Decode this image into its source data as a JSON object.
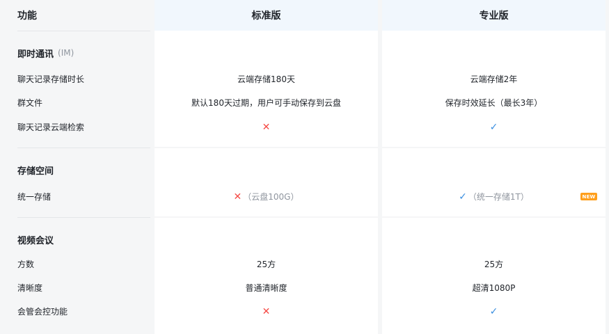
{
  "header": {
    "feature": "功能",
    "standard": "标准版",
    "professional": "专业版"
  },
  "sections": [
    {
      "title": "即时通讯",
      "subtitle": "(IM)",
      "rows": [
        {
          "label": "聊天记录存储时长",
          "standard": "云端存储180天",
          "professional": "云端存储2年"
        },
        {
          "label": "群文件",
          "standard": "默认180天过期，用户可手动保存到云盘",
          "professional": "保存时效延长（最长3年）"
        },
        {
          "label": "聊天记录云端检索",
          "standard": "✕",
          "professional": "✓"
        }
      ]
    },
    {
      "title": "存储空间",
      "rows": [
        {
          "label": "统一存储",
          "standard_icon": "✕",
          "standard": "（云盘100G）",
          "professional_icon": "✓",
          "professional": "（统一存储1T）",
          "badge": "NEW"
        }
      ]
    },
    {
      "title": "视频会议",
      "rows": [
        {
          "label": "方数",
          "standard": "25方",
          "professional": "25方"
        },
        {
          "label": "清晰度",
          "standard": "普通清晰度",
          "professional": "超清1080P"
        },
        {
          "label": "会管会控功能",
          "standard": "✕",
          "professional": "✓"
        }
      ]
    }
  ],
  "colors": {
    "cross": "#f54a45",
    "check": "#3b8fe0",
    "badge": "#ff9f1c",
    "header_bg": "#f1f7fd"
  }
}
